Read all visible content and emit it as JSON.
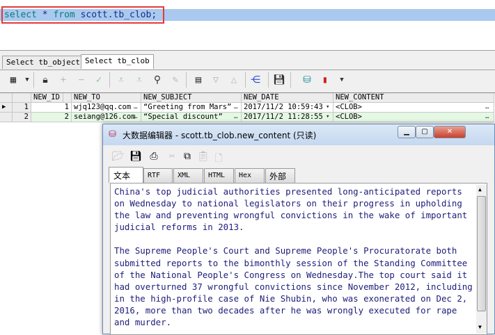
{
  "editor": {
    "query_kw1": "select",
    "query_mid": " * ",
    "query_kw2": "from",
    "query_rest": " scott.tb_clob;"
  },
  "result_tabs": [
    {
      "label": "Select tb_objects"
    },
    {
      "label": "Select tb_clob"
    }
  ],
  "grid": {
    "columns": [
      "NEW_ID",
      "NEW_TO",
      "NEW_SUBJECT",
      "NEW_DATE",
      "NEW_CONTENT"
    ],
    "rows": [
      {
        "rownum": "1",
        "new_id": "1",
        "new_to": "wjq123@qq.com",
        "new_subject": "“Greeting from Mars”",
        "new_date": "2017/11/2 10:59:43",
        "new_content": "<CLOB>"
      },
      {
        "rownum": "2",
        "new_id": "2",
        "new_to": "seiang@126.com",
        "new_subject": "“Special discount”",
        "new_date": "2017/11/2 11:28:55",
        "new_content": "<CLOB>"
      }
    ]
  },
  "dialog": {
    "title": "大数据编辑器 - scott.tb_clob.new_content (只读)",
    "tabs": [
      "文本",
      "RTF",
      "XML",
      "HTML",
      "Hex",
      "外部"
    ],
    "content": "China's top judicial authorities presented long-anticipated reports on Wednesday to national legislators on their progress in upholding the law and preventing wrongful convictions in the wake of important judicial reforms in 2013.\n\nThe Supreme People's Court and Supreme People's Procuratorate both submitted reports to the bimonthly session of the Standing Committee of the National People's Congress on Wednesday.The top court said it had overturned 37 wrongful convictions since November 2012, including in the high-profile case of Nie Shubin, who was exonerated on Dec 2, 2016, more than two decades after he was wrongly executed for rape and murder."
  },
  "colors": {
    "selection": "#a9c9ee",
    "highlight_box": "#e53935",
    "row_alt": "#e4f8e4"
  }
}
